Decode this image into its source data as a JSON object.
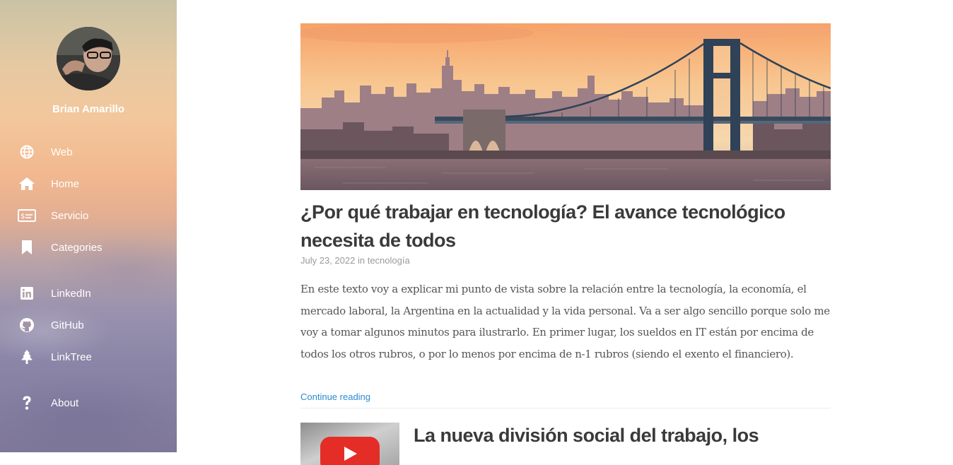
{
  "sidebar": {
    "author_name": "Brian Amarillo",
    "nav": [
      {
        "label": "Web",
        "icon": "globe-icon"
      },
      {
        "label": "Home",
        "icon": "home-icon"
      },
      {
        "label": "Servicio",
        "icon": "money-bill-icon"
      },
      {
        "label": "Categories",
        "icon": "bookmark-icon"
      },
      {
        "label": "LinkedIn",
        "icon": "linkedin-icon"
      },
      {
        "label": "GitHub",
        "icon": "github-icon"
      },
      {
        "label": "LinkTree",
        "icon": "tree-icon"
      },
      {
        "label": "About",
        "icon": "question-icon"
      }
    ]
  },
  "posts": [
    {
      "title": "¿Por qué trabajar en tecnología? El avance tecnológico necesita de todos",
      "date": "July 23, 2022",
      "in_text": "in",
      "category": "tecnología",
      "excerpt": "En este texto voy a explicar mi punto de vista sobre la relación entre la tecnología, la economía, el mercado laboral, la Argentina en la actualidad y la vida personal. Va a ser algo sencillo porque solo me voy a tomar algunos minutos para ilustrarlo. En primer lugar, los sueldos en IT están por encima de todos los otros rubros, o por lo menos por encima de n-1 rubros (siendo el exento el financiero).",
      "continue_label": "Continue reading"
    },
    {
      "title": "La nueva división social del trabajo, los"
    }
  ],
  "colors": {
    "title": "#3a3a3a",
    "link": "#2a8bd0",
    "meta": "#9a9a9a",
    "body": "#555555",
    "youtube_red": "#e52d27"
  }
}
